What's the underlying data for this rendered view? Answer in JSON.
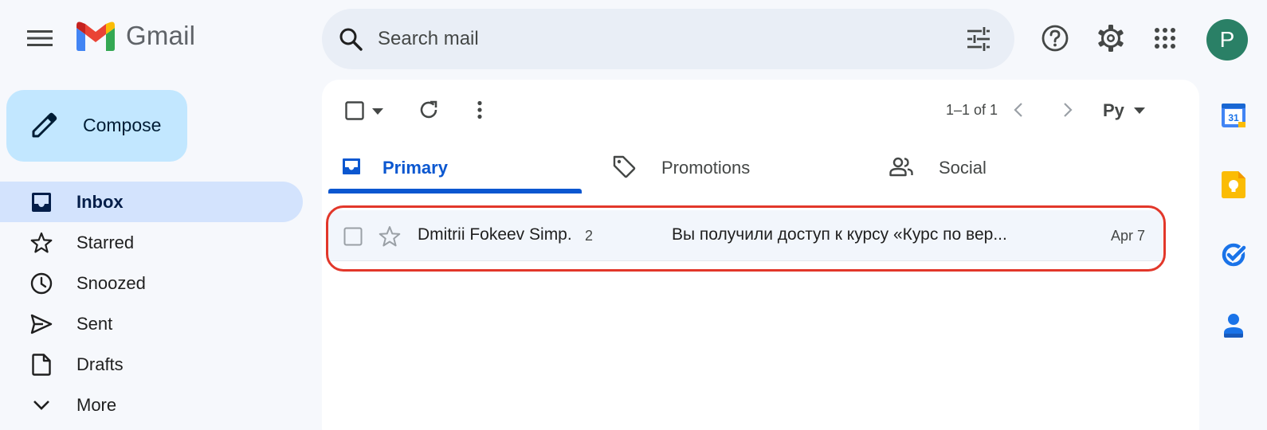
{
  "header": {
    "app_name": "Gmail",
    "search_placeholder": "Search mail",
    "avatar_initial": "P"
  },
  "compose": {
    "label": "Compose"
  },
  "nav": {
    "items": [
      {
        "label": "Inbox",
        "icon": "inbox-icon",
        "active": true
      },
      {
        "label": "Starred",
        "icon": "star-icon"
      },
      {
        "label": "Snoozed",
        "icon": "clock-icon"
      },
      {
        "label": "Sent",
        "icon": "send-icon"
      },
      {
        "label": "Drafts",
        "icon": "draft-icon"
      },
      {
        "label": "More",
        "icon": "chevron-down-icon"
      }
    ]
  },
  "toolbar": {
    "paging": "1–1 of 1",
    "language": "Ру"
  },
  "tabs": [
    {
      "label": "Primary",
      "icon": "inbox-tab-icon",
      "active": true
    },
    {
      "label": "Promotions",
      "icon": "tag-icon"
    },
    {
      "label": "Social",
      "icon": "people-icon"
    }
  ],
  "emails": [
    {
      "sender": "Dmitrii Fokeev Simp.",
      "count": "2",
      "subject": "Вы получили доступ к курсу «Курс по вер...",
      "date": "Apr 7"
    }
  ],
  "side_panel": {
    "calendar_day": "31"
  },
  "colors": {
    "accent": "#0b57d0",
    "compose_bg": "#c2e7ff",
    "nav_active_bg": "#d3e3fd",
    "highlight_outline": "#e2372a",
    "avatar_bg": "#2a8066"
  }
}
